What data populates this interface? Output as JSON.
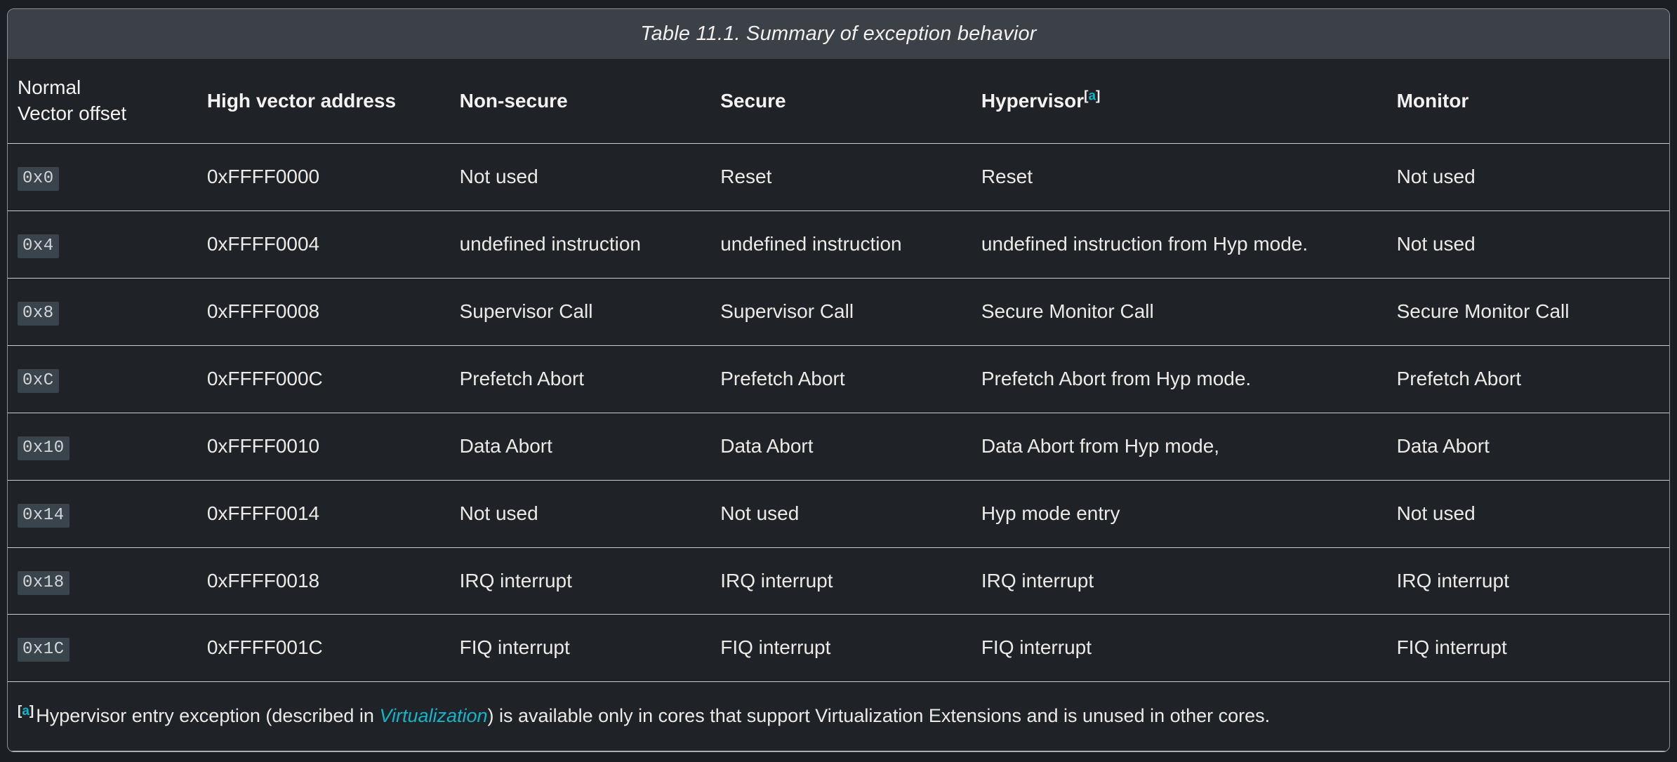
{
  "table": {
    "caption": "Table 11.1. Summary of exception behavior",
    "headers": [
      {
        "lines": [
          "Normal",
          "Vector offset"
        ],
        "bold": false,
        "footnote": null
      },
      {
        "lines": [
          "High vector address"
        ],
        "bold": true,
        "footnote": null
      },
      {
        "lines": [
          "Non-secure"
        ],
        "bold": true,
        "footnote": null
      },
      {
        "lines": [
          "Secure"
        ],
        "bold": true,
        "footnote": null
      },
      {
        "lines": [
          "Hypervisor"
        ],
        "bold": true,
        "footnote": "a"
      },
      {
        "lines": [
          "Monitor"
        ],
        "bold": true,
        "footnote": null
      }
    ],
    "rows": [
      {
        "offset": "0x0",
        "address": "0xFFFF0000",
        "non_secure": "Not used",
        "secure": "Reset",
        "hypervisor": "Reset",
        "monitor": "Not used"
      },
      {
        "offset": "0x4",
        "address": "0xFFFF0004",
        "non_secure": "undefined instruction",
        "secure": "undefined instruction",
        "hypervisor": "undefined instruction from Hyp mode.",
        "monitor": "Not used"
      },
      {
        "offset": "0x8",
        "address": "0xFFFF0008",
        "non_secure": "Supervisor Call",
        "secure": "Supervisor Call",
        "hypervisor": "Secure Monitor Call",
        "monitor": "Secure Monitor Call"
      },
      {
        "offset": "0xC",
        "address": "0xFFFF000C",
        "non_secure": "Prefetch Abort",
        "secure": "Prefetch Abort",
        "hypervisor": "Prefetch Abort from Hyp mode.",
        "monitor": "Prefetch Abort"
      },
      {
        "offset": "0x10",
        "address": "0xFFFF0010",
        "non_secure": "Data Abort",
        "secure": "Data Abort",
        "hypervisor": "Data Abort from Hyp mode,",
        "monitor": "Data Abort"
      },
      {
        "offset": "0x14",
        "address": "0xFFFF0014",
        "non_secure": "Not used",
        "secure": "Not used",
        "hypervisor": "Hyp mode entry",
        "monitor": "Not used"
      },
      {
        "offset": "0x18",
        "address": "0xFFFF0018",
        "non_secure": "IRQ interrupt",
        "secure": "IRQ interrupt",
        "hypervisor": "IRQ interrupt",
        "monitor": "IRQ interrupt"
      },
      {
        "offset": "0x1C",
        "address": "0xFFFF001C",
        "non_secure": "FIQ interrupt",
        "secure": "FIQ interrupt",
        "hypervisor": "FIQ interrupt",
        "monitor": "FIQ interrupt"
      }
    ],
    "footnote": {
      "marker": "a",
      "text_before": "Hypervisor entry exception (described in ",
      "link_text": "Virtualization",
      "text_after": ") is available only in cores that support Virtualization Extensions and is unused in other cores."
    }
  },
  "colors": {
    "page_background": "#1b1e22",
    "caption_background": "#3c4147",
    "table_background": "#1f2226",
    "border": "#c9ccce",
    "frame_border": "#8d9297",
    "text": "#eceae7",
    "accent_link": "#13b4c9",
    "code_chip_background": "#3a444c",
    "code_chip_text": "#d3d7da"
  }
}
